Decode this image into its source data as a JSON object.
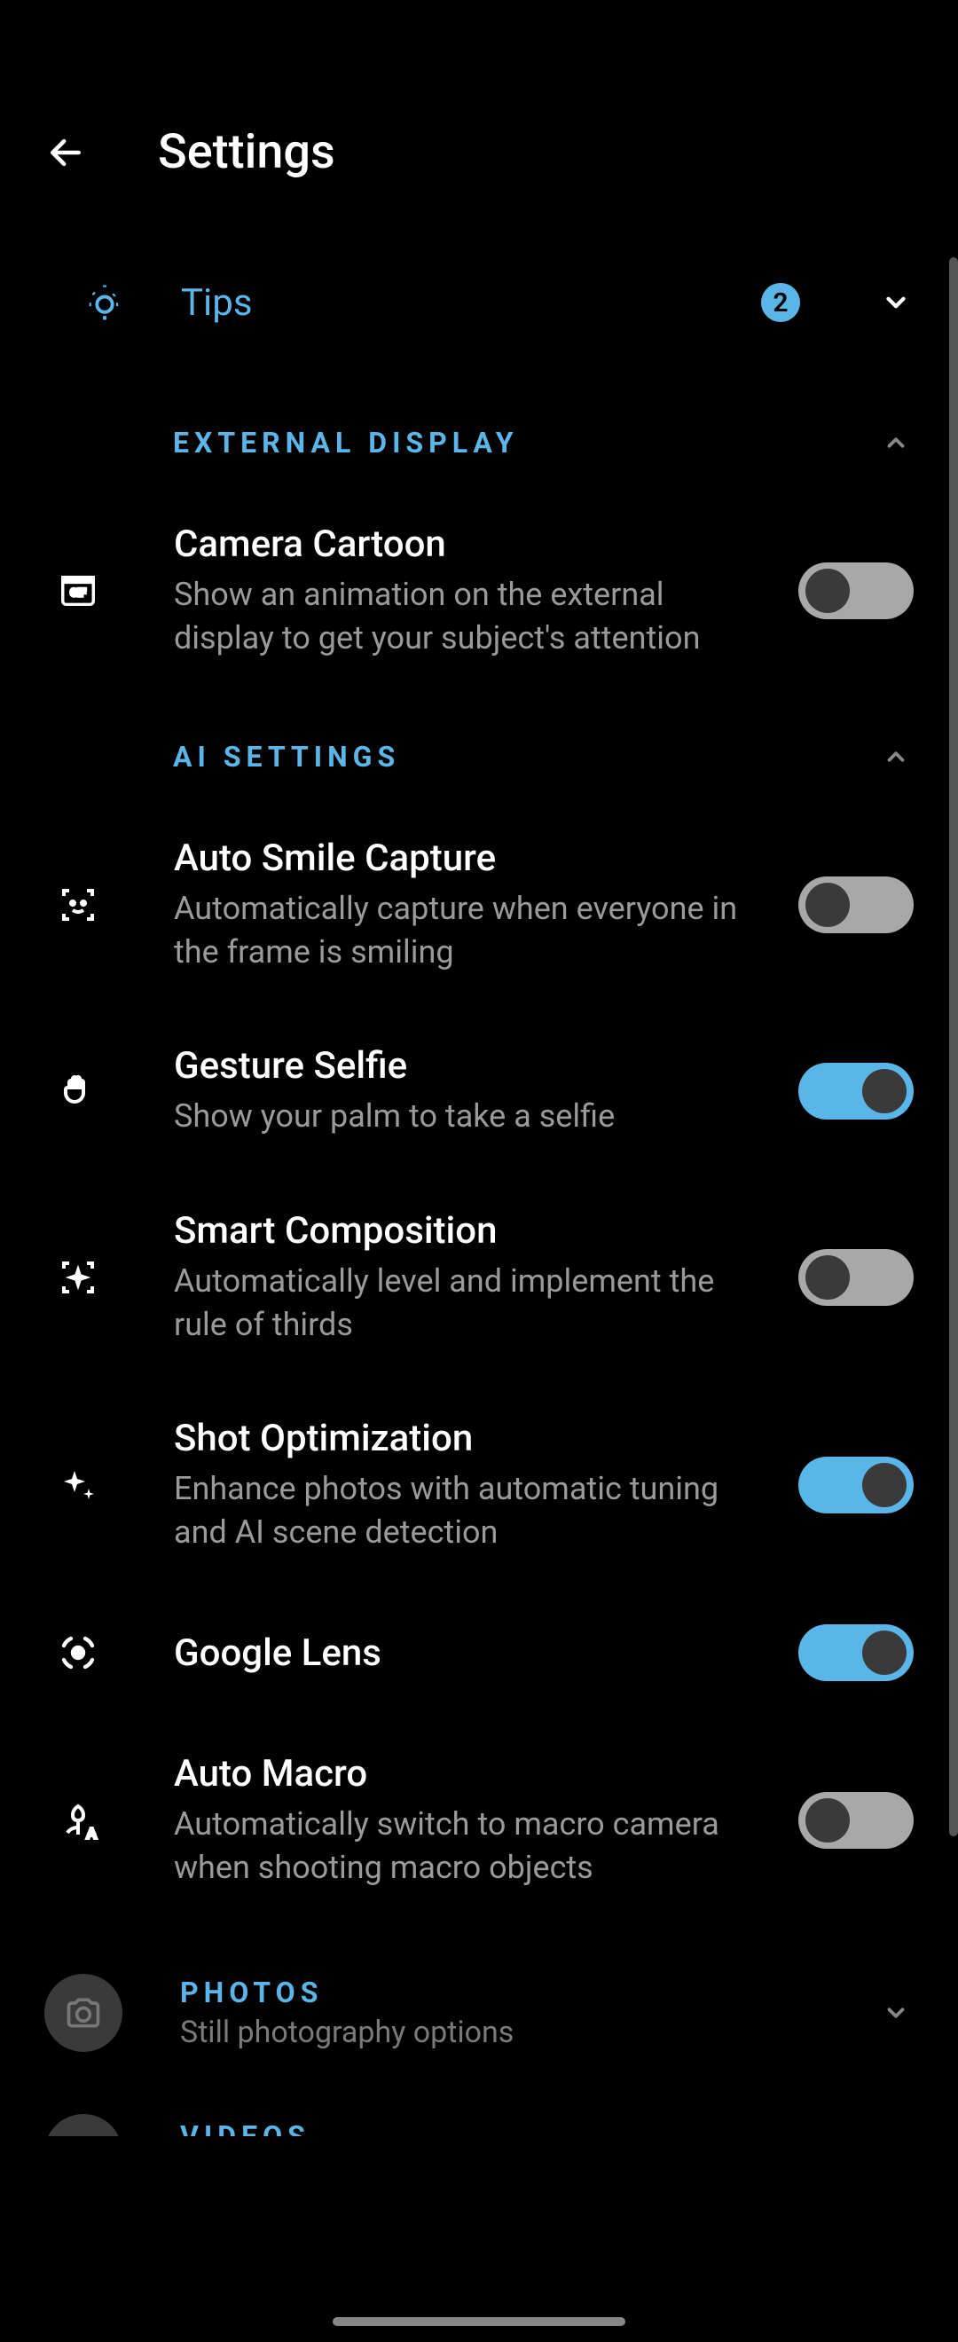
{
  "header": {
    "title": "Settings"
  },
  "tips": {
    "label": "Tips",
    "badge": "2"
  },
  "sections": {
    "external_display": {
      "title": "External Display",
      "items": [
        {
          "title": "Camera Cartoon",
          "desc": "Show an animation on the external display to get your subject's attention",
          "on": false
        }
      ]
    },
    "ai_settings": {
      "title": "AI Settings",
      "items": [
        {
          "title": "Auto Smile Capture",
          "desc": "Automatically capture when everyone in the frame is smiling",
          "on": false
        },
        {
          "title": "Gesture Selfie",
          "desc": "Show your palm to take a selfie",
          "on": true
        },
        {
          "title": "Smart Composition",
          "desc": "Automatically level and implement the rule of thirds",
          "on": false
        },
        {
          "title": "Shot Optimization",
          "desc": "Enhance photos with automatic tuning and AI scene detection",
          "on": true
        },
        {
          "title": "Google Lens",
          "desc": "",
          "on": true
        },
        {
          "title": "Auto Macro",
          "desc": "Automatically switch to macro camera when shooting macro objects",
          "on": false
        }
      ]
    }
  },
  "categories": {
    "photos": {
      "title": "Photos",
      "desc": "Still photography options"
    },
    "videos": {
      "title": "Videos"
    }
  },
  "colors": {
    "accent": "#5ab5e8",
    "bg": "#000000"
  }
}
